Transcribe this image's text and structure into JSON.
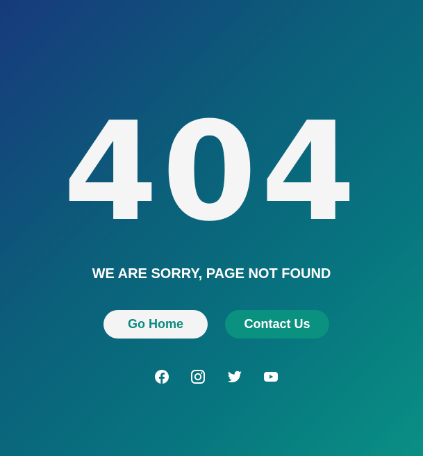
{
  "error": {
    "code": "404",
    "message": "WE ARE SORRY, PAGE NOT FOUND"
  },
  "actions": {
    "home_label": "Go Home",
    "contact_label": "Contact Us"
  },
  "social": {
    "icons": [
      "facebook-icon",
      "instagram-icon",
      "twitter-icon",
      "youtube-icon"
    ]
  },
  "colors": {
    "gradient_start": "#173a7c",
    "gradient_end": "#0a8f84",
    "text": "#f5f5f5",
    "accent": "#0b9180",
    "home_text": "#0b8a7f"
  }
}
